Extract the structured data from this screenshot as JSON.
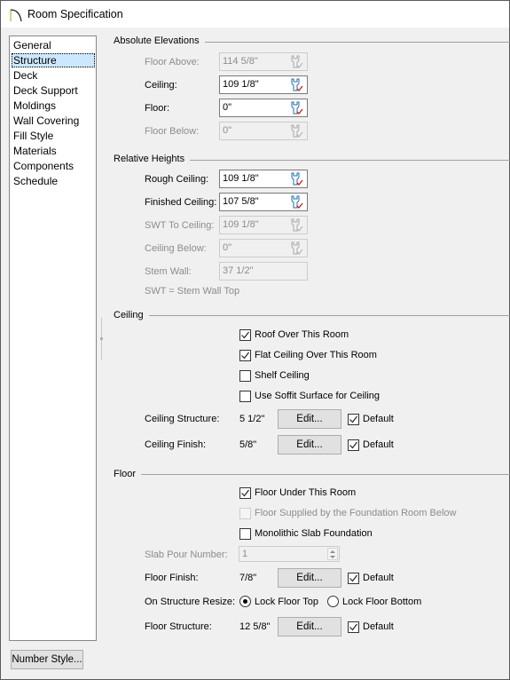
{
  "window": {
    "title": "Room Specification",
    "icon": "room-arc-icon"
  },
  "sidebar": {
    "items": [
      {
        "label": "General",
        "selected": false
      },
      {
        "label": "Structure",
        "selected": true
      },
      {
        "label": "Deck",
        "selected": false
      },
      {
        "label": "Deck Support",
        "selected": false
      },
      {
        "label": "Moldings",
        "selected": false
      },
      {
        "label": "Wall Covering",
        "selected": false
      },
      {
        "label": "Fill Style",
        "selected": false
      },
      {
        "label": "Materials",
        "selected": false
      },
      {
        "label": "Components",
        "selected": false
      },
      {
        "label": "Schedule",
        "selected": false
      }
    ],
    "number_style_label": "Number Style..."
  },
  "absolute_elevations": {
    "title": "Absolute Elevations",
    "fields": [
      {
        "label": "Floor Above:",
        "value": "114 5/8\"",
        "enabled": false,
        "icon": "wrench-check-icon"
      },
      {
        "label": "Ceiling:",
        "value": "109 1/8\"",
        "enabled": true,
        "icon": "wrench-check-icon"
      },
      {
        "label": "Floor:",
        "value": "0\"",
        "enabled": true,
        "icon": "wrench-check-icon"
      },
      {
        "label": "Floor Below:",
        "value": "0\"",
        "enabled": false,
        "icon": "wrench-check-icon"
      }
    ]
  },
  "relative_heights": {
    "title": "Relative Heights",
    "fields": [
      {
        "label": "Rough Ceiling:",
        "value": "109 1/8\"",
        "enabled": true,
        "icon": "wrench-check-icon"
      },
      {
        "label": "Finished Ceiling:",
        "value": "107 5/8\"",
        "enabled": true,
        "icon": "wrench-check-icon"
      },
      {
        "label": "SWT To Ceiling:",
        "value": "109 1/8\"",
        "enabled": false,
        "icon": "wrench-check-icon"
      },
      {
        "label": "Ceiling Below:",
        "value": "0\"",
        "enabled": false,
        "icon": "wrench-check-icon"
      },
      {
        "label": "Stem Wall:",
        "value": "37 1/2\"",
        "enabled": false
      }
    ],
    "note": "SWT = Stem Wall Top"
  },
  "ceiling": {
    "title": "Ceiling",
    "checkboxes": [
      {
        "label": "Roof Over This Room",
        "checked": true,
        "enabled": true
      },
      {
        "label": "Flat Ceiling Over This Room",
        "checked": true,
        "enabled": true
      },
      {
        "label": "Shelf Ceiling",
        "checked": false,
        "enabled": true
      },
      {
        "label": "Use Soffit Surface for Ceiling",
        "checked": false,
        "enabled": true
      }
    ],
    "structure": {
      "label": "Ceiling Structure:",
      "value": "5 1/2\"",
      "edit_label": "Edit...",
      "default_label": "Default",
      "default_checked": true
    },
    "finish": {
      "label": "Ceiling Finish:",
      "value": "5/8\"",
      "edit_label": "Edit...",
      "default_label": "Default",
      "default_checked": true
    }
  },
  "floor": {
    "title": "Floor",
    "checkboxes": [
      {
        "label": "Floor Under This Room",
        "checked": true,
        "enabled": true
      },
      {
        "label": "Floor Supplied by the Foundation Room Below",
        "checked": false,
        "enabled": false
      },
      {
        "label": "Monolithic Slab Foundation",
        "checked": false,
        "enabled": true
      }
    ],
    "slab_pour": {
      "label": "Slab Pour Number:",
      "value": "1",
      "enabled": false
    },
    "finish": {
      "label": "Floor Finish:",
      "value": "7/8\"",
      "edit_label": "Edit...",
      "default_label": "Default",
      "default_checked": true
    },
    "resize": {
      "label": "On Structure Resize:",
      "options": [
        {
          "label": "Lock Floor Top",
          "selected": true
        },
        {
          "label": "Lock Floor Bottom",
          "selected": false
        }
      ]
    },
    "structure": {
      "label": "Floor Structure:",
      "value": "12 5/8\"",
      "edit_label": "Edit...",
      "default_label": "Default",
      "default_checked": true
    }
  },
  "colors": {
    "selection": "#cce8ff",
    "wrench_blue": "#1e6fa8",
    "check_red": "#d42020",
    "disabled_text": "#8c8c8c"
  }
}
